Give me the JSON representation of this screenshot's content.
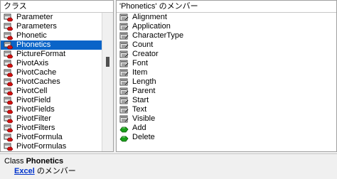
{
  "left_pane": {
    "header": "クラス",
    "items": [
      {
        "label": "Parameter",
        "selected": false
      },
      {
        "label": "Parameters",
        "selected": false
      },
      {
        "label": "Phonetic",
        "selected": false
      },
      {
        "label": "Phonetics",
        "selected": true
      },
      {
        "label": "PictureFormat",
        "selected": false
      },
      {
        "label": "PivotAxis",
        "selected": false
      },
      {
        "label": "PivotCache",
        "selected": false
      },
      {
        "label": "PivotCaches",
        "selected": false
      },
      {
        "label": "PivotCell",
        "selected": false
      },
      {
        "label": "PivotField",
        "selected": false
      },
      {
        "label": "PivotFields",
        "selected": false
      },
      {
        "label": "PivotFilter",
        "selected": false
      },
      {
        "label": "PivotFilters",
        "selected": false
      },
      {
        "label": "PivotFormula",
        "selected": false
      },
      {
        "label": "PivotFormulas",
        "selected": false
      }
    ]
  },
  "right_pane": {
    "header": "'Phonetics' のメンバー",
    "items": [
      {
        "label": "Alignment",
        "icon": "property-icon"
      },
      {
        "label": "Application",
        "icon": "property-icon"
      },
      {
        "label": "CharacterType",
        "icon": "property-icon"
      },
      {
        "label": "Count",
        "icon": "property-icon"
      },
      {
        "label": "Creator",
        "icon": "property-icon"
      },
      {
        "label": "Font",
        "icon": "property-icon"
      },
      {
        "label": "Item",
        "icon": "property-icon"
      },
      {
        "label": "Length",
        "icon": "property-icon"
      },
      {
        "label": "Parent",
        "icon": "property-icon"
      },
      {
        "label": "Start",
        "icon": "property-icon"
      },
      {
        "label": "Text",
        "icon": "property-icon"
      },
      {
        "label": "Visible",
        "icon": "property-icon"
      },
      {
        "label": "Add",
        "icon": "method-icon"
      },
      {
        "label": "Delete",
        "icon": "method-icon"
      }
    ]
  },
  "status": {
    "prefix": "Class",
    "class_name": "Phonetics",
    "library_link": "Excel",
    "library_suffix": "のメンバー"
  },
  "colors": {
    "selection": "#0a64c8",
    "link": "#0033cc"
  }
}
